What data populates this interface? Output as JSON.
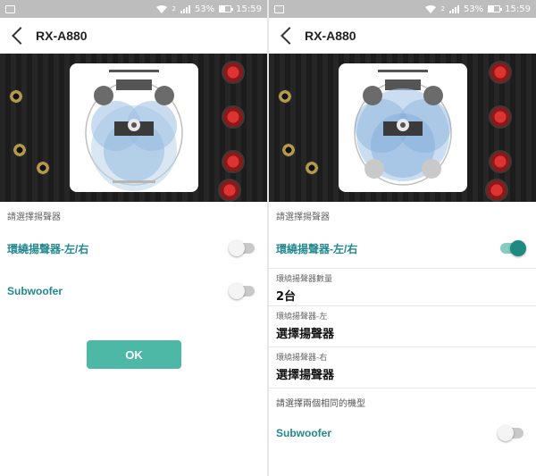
{
  "status_bar": {
    "battery": "53%",
    "time": "15:59",
    "sim_label": "2"
  },
  "left_panel": {
    "title": "RX-A880",
    "section_label": "請選擇揚聲器",
    "surround_label": "環繞揚聲器-左/右",
    "surround_on": false,
    "subwoofer_label": "Subwoofer",
    "subwoofer_on": false,
    "ok_label": "OK"
  },
  "right_panel": {
    "title": "RX-A880",
    "section_label": "請選擇揚聲器",
    "surround_label": "環繞揚聲器-左/右",
    "surround_on": true,
    "count_caption": "環繞揚聲器數量",
    "count_value": "2台",
    "left_caption": "環繞揚聲器-左",
    "left_value": "選擇揚聲器",
    "right_caption": "環繞揚聲器-右",
    "right_value": "選擇揚聲器",
    "note": "請選擇兩個相同的機型",
    "subwoofer_label": "Subwoofer",
    "subwoofer_on": false
  },
  "colors": {
    "accent": "#23898f",
    "ok_button": "#4db8a6",
    "toggle_on": "#1f8a82"
  }
}
